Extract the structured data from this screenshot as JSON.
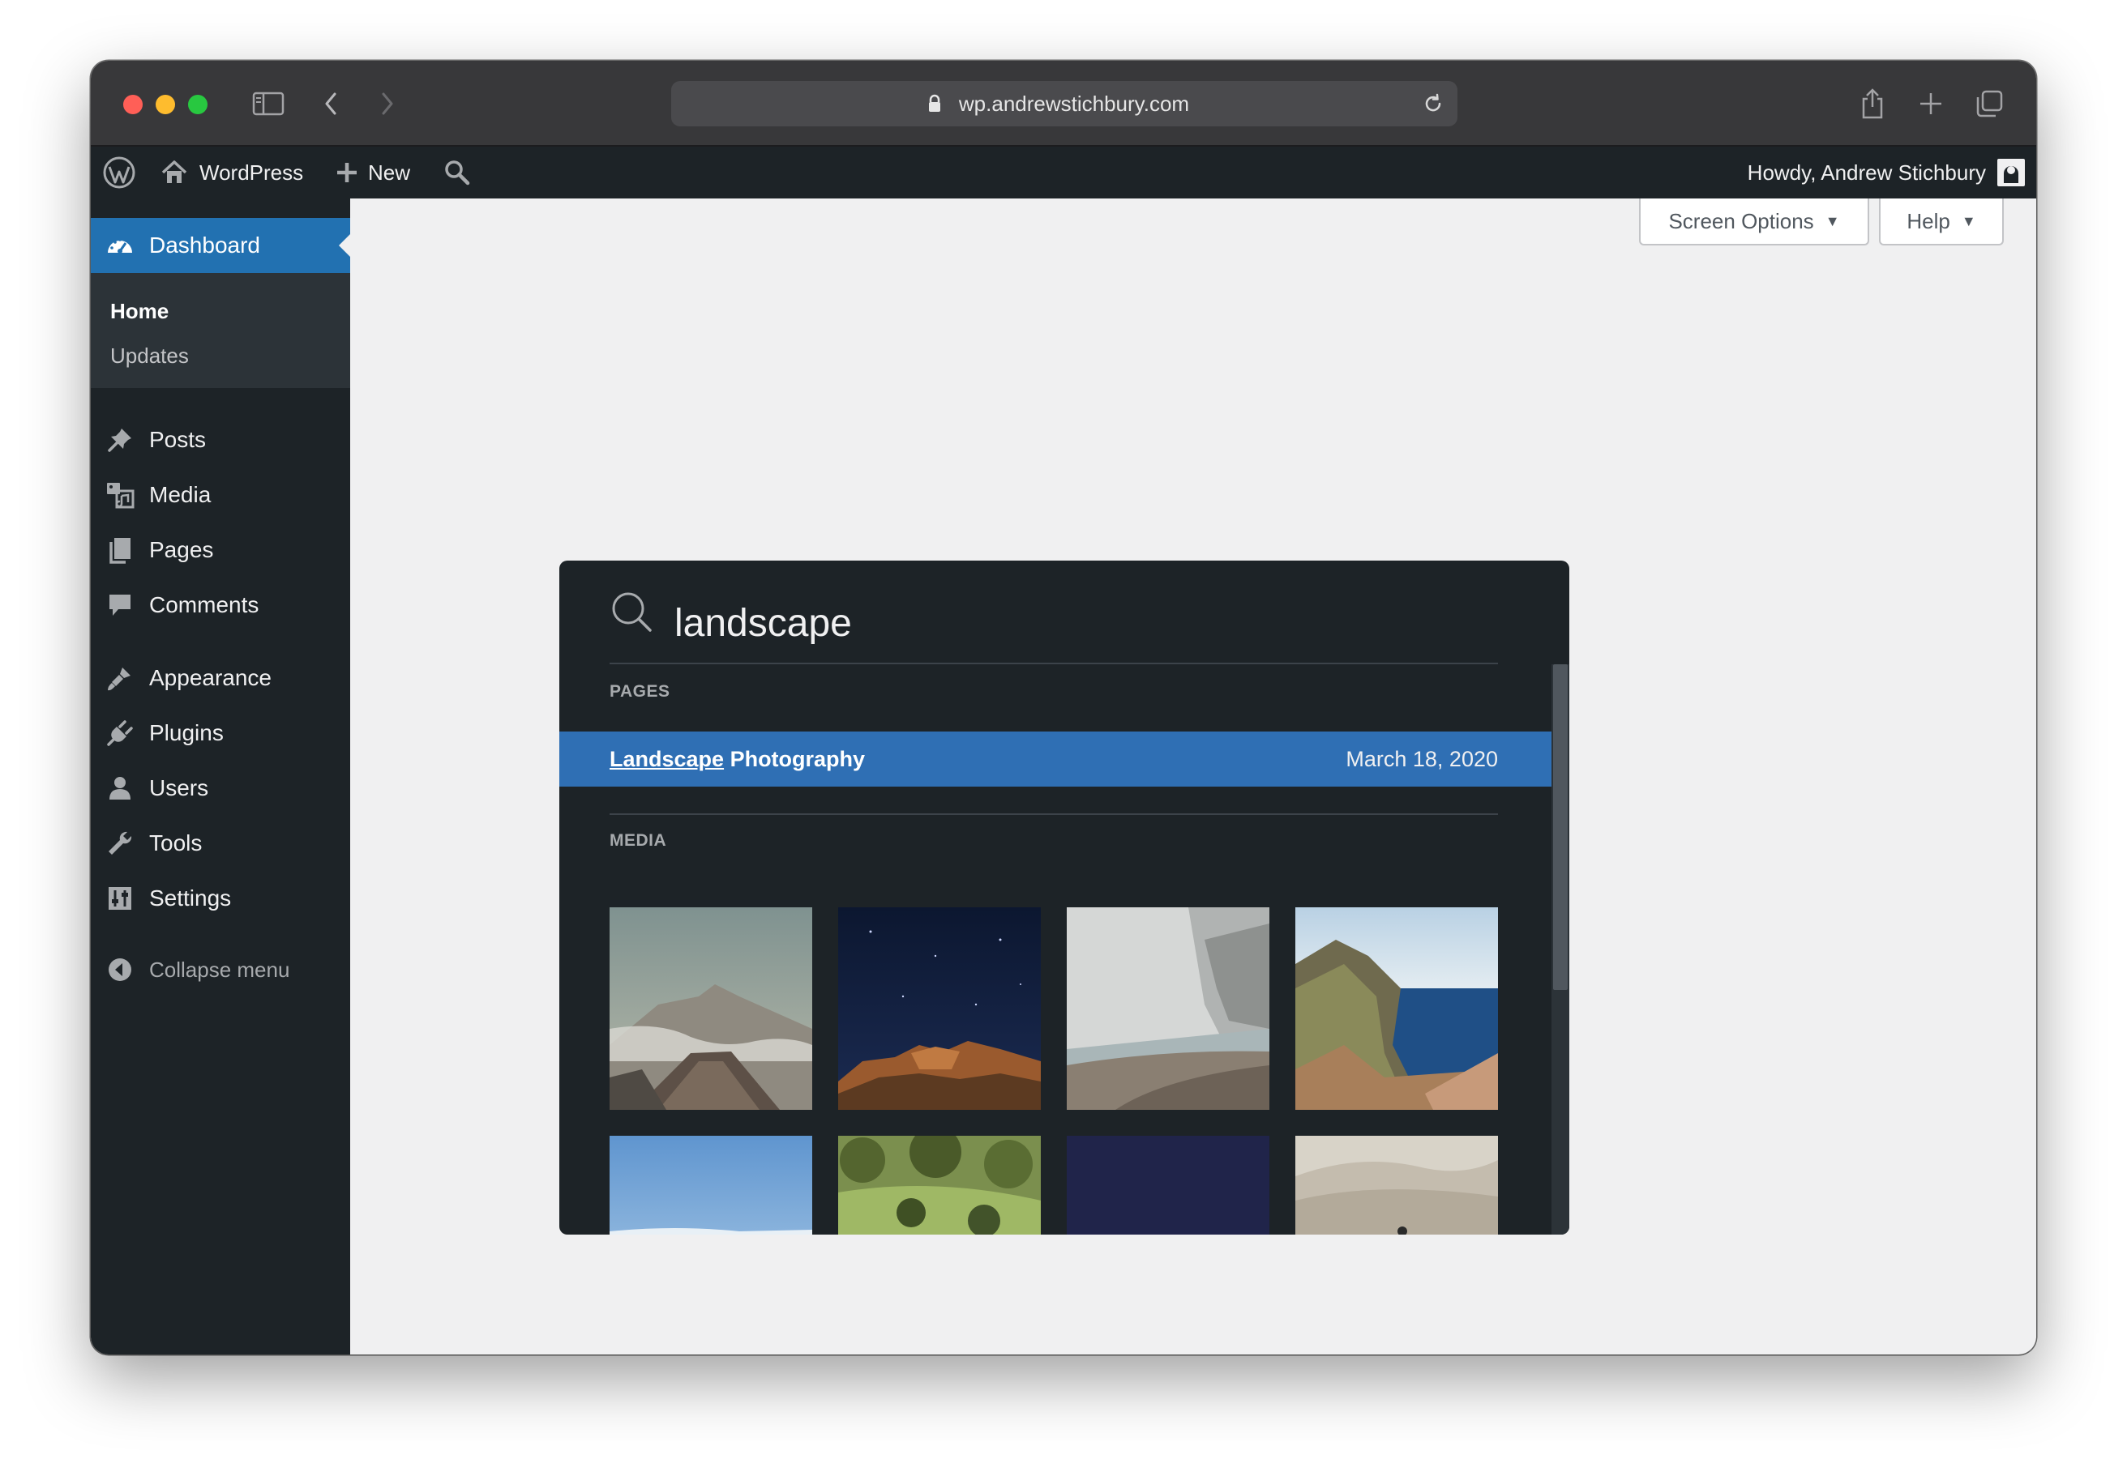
{
  "browser": {
    "url": "wp.andrewstichbury.com"
  },
  "adminbar": {
    "site_name": "WordPress",
    "new_label": "New",
    "greeting": "Howdy, Andrew Stichbury"
  },
  "sidebar": {
    "dashboard": "Dashboard",
    "submenu": [
      "Home",
      "Updates"
    ],
    "items": [
      {
        "label": "Posts",
        "icon": "pin-icon"
      },
      {
        "label": "Media",
        "icon": "media-icon"
      },
      {
        "label": "Pages",
        "icon": "pages-icon"
      },
      {
        "label": "Comments",
        "icon": "comment-icon"
      },
      {
        "label": "Appearance",
        "icon": "brush-icon"
      },
      {
        "label": "Plugins",
        "icon": "plug-icon"
      },
      {
        "label": "Users",
        "icon": "user-icon"
      },
      {
        "label": "Tools",
        "icon": "wrench-icon"
      },
      {
        "label": "Settings",
        "icon": "settings-icon"
      }
    ],
    "collapse": "Collapse menu"
  },
  "screen_options": {
    "screen_options_label": "Screen Options",
    "help_label": "Help"
  },
  "search": {
    "query": "landscape",
    "pages_heading": "PAGES",
    "result": {
      "title_highlight": "Landscape",
      "title_rest": " Photography",
      "date": "March 18, 2020"
    },
    "media_heading": "MEDIA",
    "media_count": 8
  },
  "colors": {
    "admin_dark": "#1d2327",
    "accent_blue": "#2271b1",
    "result_highlight": "#2f6fb4"
  }
}
